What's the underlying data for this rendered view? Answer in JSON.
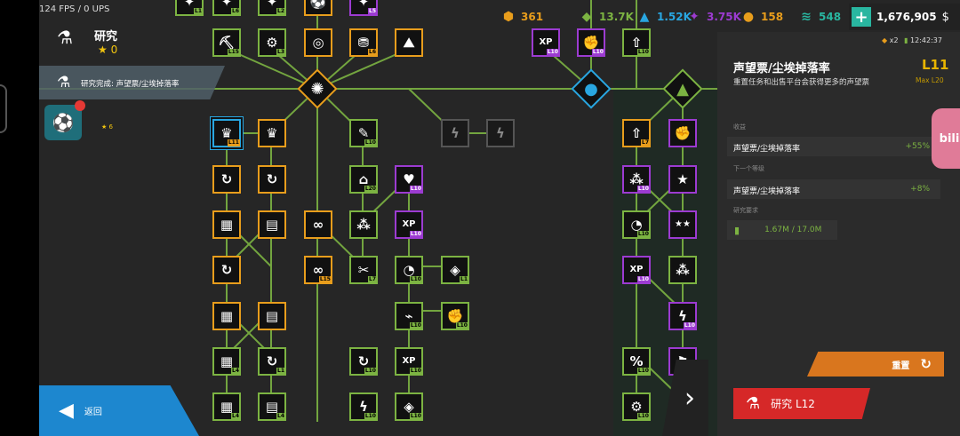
{
  "status": {
    "fps": "124 FPS / 0 UPS"
  },
  "header": {
    "title": "研究",
    "stars": "0"
  },
  "notice": {
    "text": "研究完成: 声望票/尘埃掉落率"
  },
  "badge": {
    "stars": "6"
  },
  "resources": [
    {
      "icon": "gem-icon",
      "value": "361",
      "color": "#e89d1c"
    },
    {
      "icon": "crystal-icon",
      "value": "13.7K",
      "color": "#7cb342"
    },
    {
      "icon": "shard-icon",
      "value": "1.52K",
      "color": "#29a6e0"
    },
    {
      "icon": "rune-icon",
      "value": "3.75K",
      "color": "#9c3bd1"
    },
    {
      "icon": "ball-icon",
      "value": "158",
      "color": "#e89d1c"
    },
    {
      "icon": "wave-icon",
      "value": "548",
      "color": "#29b6a0"
    }
  ],
  "cash": {
    "value": "1,676,905"
  },
  "panel": {
    "boost": "x2",
    "timer": "12:42:37",
    "title": "声望票/尘埃掉落率",
    "level": "L11",
    "max_level": "Max L20",
    "description": "重置任务和出售平台会获得更多的声望票",
    "income_label": "收益",
    "income_row": "声望票/尘埃掉落率",
    "income_value": "+55%",
    "next_label": "下一个等级",
    "next_row": "声望票/尘埃掉落率",
    "next_value": "+8%",
    "req_label": "研究要求",
    "req_value": "1.67M / 17.0M"
  },
  "buttons": {
    "reset": "重置",
    "research": "研究 L12",
    "back": "返回"
  },
  "colors": {
    "orange": "#e89d1c",
    "green": "#7cb342",
    "purple": "#9c3bd1",
    "blue": "#29a6e0",
    "red": "#d62828"
  },
  "tree_nodes": [
    {
      "id": "n-crown-sel",
      "color": "o",
      "glyph": "♛",
      "level": "L11",
      "selected": true
    },
    {
      "id": "n-crown",
      "color": "o",
      "glyph": "♛",
      "level": ""
    },
    {
      "id": "n-pickaxe",
      "color": "g",
      "glyph": "⛏",
      "level": "L15"
    },
    {
      "id": "n-gear",
      "color": "g",
      "glyph": "⚙",
      "level": "L3"
    },
    {
      "id": "n-orb",
      "color": "o",
      "glyph": "◎",
      "level": ""
    },
    {
      "id": "n-gift",
      "color": "o",
      "glyph": "⛃",
      "level": "L6"
    },
    {
      "id": "n-mount",
      "color": "o",
      "glyph": "⛰",
      "level": ""
    },
    {
      "id": "n-lv1",
      "color": "g",
      "glyph": "✦",
      "level": "L1"
    },
    {
      "id": "n-lv6",
      "color": "g",
      "glyph": "✦",
      "level": "L6"
    },
    {
      "id": "n-lv2",
      "color": "g",
      "glyph": "✦",
      "level": "L2"
    },
    {
      "id": "n-ball",
      "color": "o",
      "glyph": "⚽",
      "level": ""
    },
    {
      "id": "n-lv5",
      "color": "p",
      "glyph": "✦",
      "level": "L5"
    },
    {
      "id": "n-pen",
      "color": "g",
      "glyph": "✎",
      "level": "L10"
    },
    {
      "id": "n-bolt1",
      "color": "d",
      "glyph": "ϟ",
      "level": ""
    },
    {
      "id": "n-bolt2",
      "color": "d",
      "glyph": "ϟ",
      "level": ""
    },
    {
      "id": "n-swirl",
      "color": "o",
      "glyph": "↻",
      "level": ""
    },
    {
      "id": "n-giftcycle",
      "color": "o",
      "glyph": "↻",
      "level": ""
    },
    {
      "id": "n-house",
      "color": "g",
      "glyph": "⌂",
      "level": "L20"
    },
    {
      "id": "n-heart",
      "color": "p",
      "glyph": "♥",
      "level": "L10"
    },
    {
      "id": "n-blocks",
      "color": "o",
      "glyph": "▦",
      "level": ""
    },
    {
      "id": "n-card",
      "color": "o",
      "glyph": "▤",
      "level": ""
    },
    {
      "id": "n-infinity",
      "color": "o",
      "glyph": "∞",
      "level": ""
    },
    {
      "id": "n-nodes",
      "color": "g",
      "glyph": "⁂",
      "level": ""
    },
    {
      "id": "n-xp1",
      "color": "p",
      "glyph": "XP",
      "level": "L10"
    },
    {
      "id": "n-swirl2",
      "color": "o",
      "glyph": "↻",
      "level": ""
    },
    {
      "id": "n-inf15",
      "color": "o",
      "glyph": "∞",
      "level": "L15"
    },
    {
      "id": "n-bag",
      "color": "g",
      "glyph": "✂",
      "level": "L7"
    },
    {
      "id": "n-dial1",
      "color": "g",
      "glyph": "◔",
      "level": "L10"
    },
    {
      "id": "n-bag2",
      "color": "g",
      "glyph": "◈",
      "level": "L1"
    },
    {
      "id": "n-blocks2",
      "color": "o",
      "glyph": "▦",
      "level": ""
    },
    {
      "id": "n-card2",
      "color": "o",
      "glyph": "▤",
      "level": ""
    },
    {
      "id": "n-graph",
      "color": "g",
      "glyph": "⌁",
      "level": "L10"
    },
    {
      "id": "n-fist",
      "color": "g",
      "glyph": "✊",
      "level": "L10"
    },
    {
      "id": "n-blocks3",
      "color": "g",
      "glyph": "▦",
      "level": "L4"
    },
    {
      "id": "n-giftcycle2",
      "color": "g",
      "glyph": "↻",
      "level": "L1"
    },
    {
      "id": "n-spin",
      "color": "g",
      "glyph": "↻",
      "level": "L10"
    },
    {
      "id": "n-xp2",
      "color": "g",
      "glyph": "XP",
      "level": "L10"
    },
    {
      "id": "n-blocks4",
      "color": "g",
      "glyph": "▦",
      "level": "L4"
    },
    {
      "id": "n-card3",
      "color": "g",
      "glyph": "▤",
      "level": "L4"
    },
    {
      "id": "n-bolt3",
      "color": "g",
      "glyph": "ϟ",
      "level": "L10"
    },
    {
      "id": "n-sell",
      "color": "g",
      "glyph": "◈",
      "level": "L10"
    },
    {
      "id": "n-xpmax",
      "color": "p",
      "glyph": "XP",
      "level": "L10"
    },
    {
      "id": "n-fist2",
      "color": "p",
      "glyph": "✊",
      "level": "L10"
    },
    {
      "id": "n-arrow",
      "color": "g",
      "glyph": "⇧",
      "level": "L10"
    },
    {
      "id": "n-arrow2",
      "color": "o",
      "glyph": "⇧",
      "level": "L7"
    },
    {
      "id": "n-fist3",
      "color": "p",
      "glyph": "✊",
      "level": ""
    },
    {
      "id": "n-nodes2",
      "color": "p",
      "glyph": "⁂",
      "level": "L10"
    },
    {
      "id": "n-star",
      "color": "p",
      "glyph": "★",
      "level": ""
    },
    {
      "id": "n-dial2",
      "color": "g",
      "glyph": "◔",
      "level": "L10"
    },
    {
      "id": "n-stars2",
      "color": "p",
      "glyph": "★★",
      "level": ""
    },
    {
      "id": "n-xp3",
      "color": "p",
      "glyph": "XP",
      "level": "L10"
    },
    {
      "id": "n-stars3",
      "color": "g",
      "glyph": "⁂",
      "level": ""
    },
    {
      "id": "n-bolt4",
      "color": "p",
      "glyph": "ϟ",
      "level": "L10"
    },
    {
      "id": "n-pct",
      "color": "g",
      "glyph": "%",
      "level": "L10"
    },
    {
      "id": "n-flag",
      "color": "p",
      "glyph": "⚑",
      "level": ""
    },
    {
      "id": "n-cog2",
      "color": "g",
      "glyph": "⚙",
      "level": "L10"
    }
  ],
  "hubs": [
    {
      "id": "hub-main",
      "color": "o",
      "glyph": "✺"
    },
    {
      "id": "hub-green",
      "color": "g",
      "glyph": "▲"
    },
    {
      "id": "hub-blue",
      "color": "b",
      "glyph": "●"
    }
  ]
}
